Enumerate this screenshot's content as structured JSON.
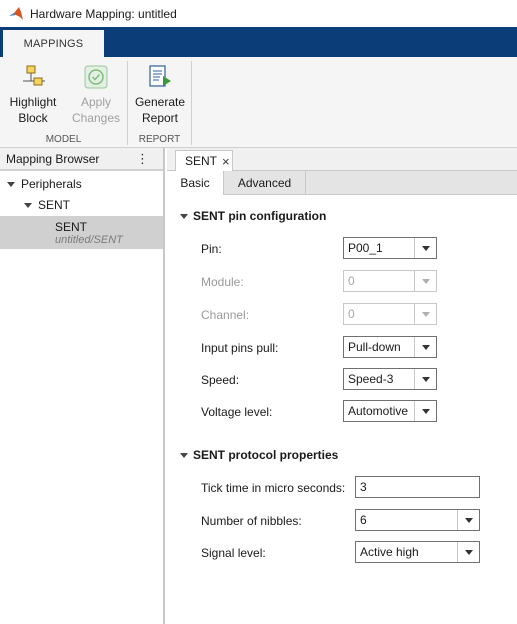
{
  "window": {
    "title": "Hardware Mapping: untitled"
  },
  "tabstrip": {
    "active_tab": "MAPPINGS"
  },
  "ribbon": {
    "highlight": {
      "line1": "Highlight",
      "line2": "Block"
    },
    "apply": {
      "line1": "Apply",
      "line2": "Changes"
    },
    "generate": {
      "line1": "Generate",
      "line2": "Report"
    },
    "group_model": "MODEL",
    "group_report": "REPORT"
  },
  "browser": {
    "title": "Mapping Browser",
    "menu_glyph": "⋮",
    "tree": {
      "root": "Peripherals",
      "child": "SENT",
      "leaf_name": "SENT",
      "leaf_path": "untitled/SENT"
    }
  },
  "doc_tab": {
    "label": "SENT",
    "close": "×"
  },
  "sub_tabs": {
    "basic": "Basic",
    "advanced": "Advanced"
  },
  "pin_config": {
    "title": "SENT pin configuration",
    "fields": {
      "pin": {
        "label": "Pin:",
        "value": "P00_1"
      },
      "module": {
        "label": "Module:",
        "value": "0"
      },
      "channel": {
        "label": "Channel:",
        "value": "0"
      },
      "pull": {
        "label": "Input pins pull:",
        "value": "Pull-down"
      },
      "speed": {
        "label": "Speed:",
        "value": "Speed-3"
      },
      "voltage": {
        "label": "Voltage level:",
        "value": "Automotive"
      }
    }
  },
  "protocol": {
    "title": "SENT protocol properties",
    "fields": {
      "tick": {
        "label": "Tick time in micro seconds:",
        "value": "3"
      },
      "nibbles": {
        "label": "Number of nibbles:",
        "value": "6"
      },
      "signal": {
        "label": "Signal level:",
        "value": "Active high"
      }
    }
  },
  "colors": {
    "tabstrip": "#0b3d78",
    "selection": "#d0d0d0",
    "apply_icon": "#3a9a3a"
  }
}
